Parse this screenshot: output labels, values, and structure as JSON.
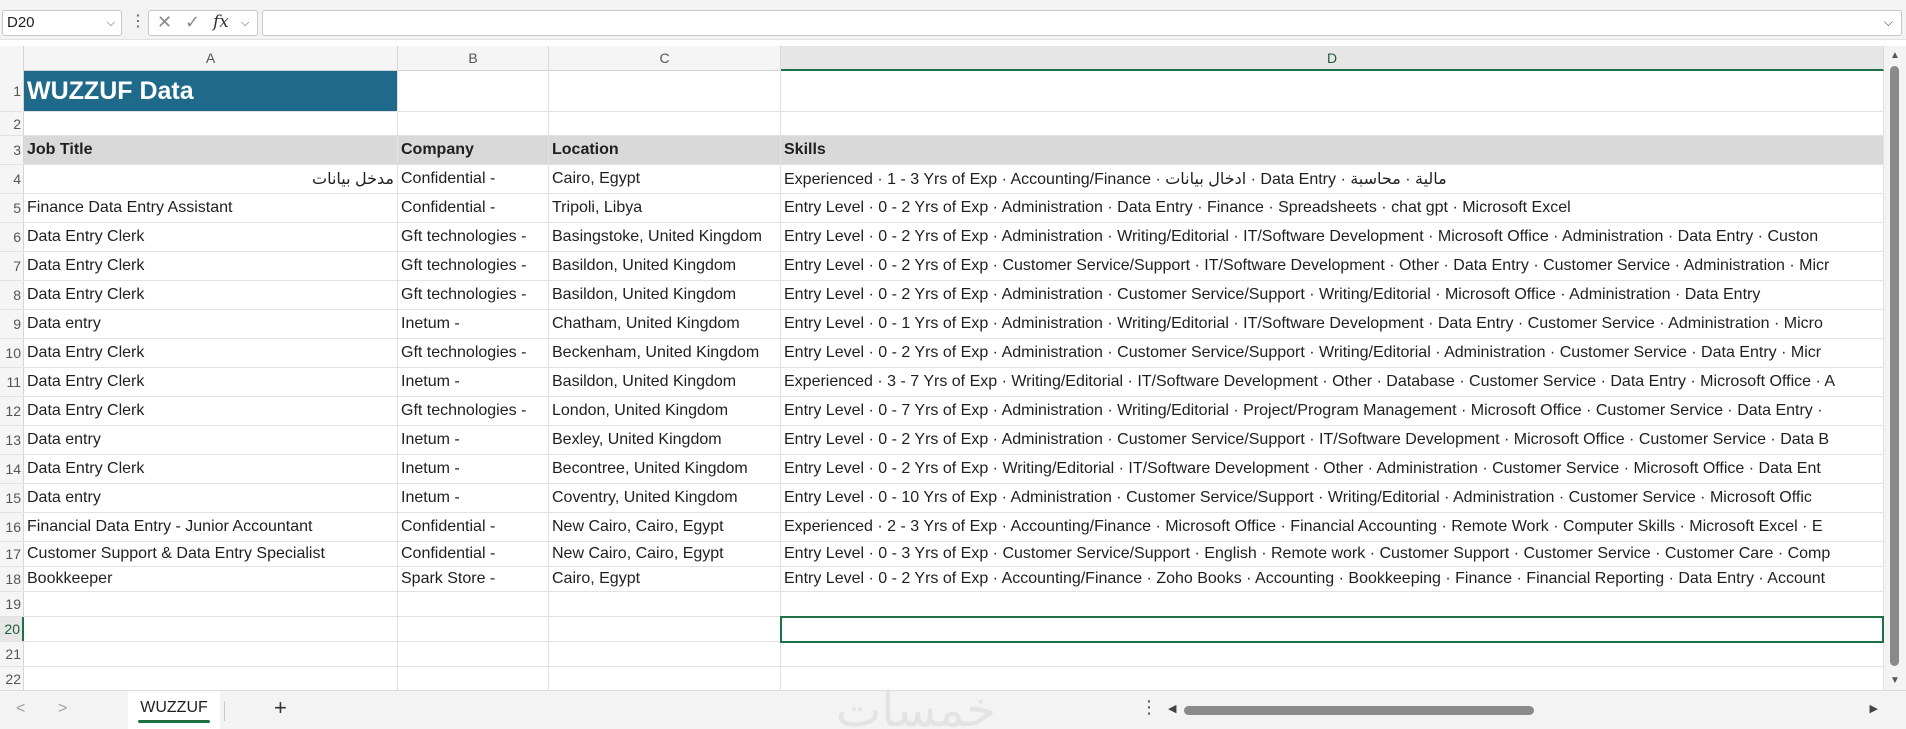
{
  "formula_bar": {
    "name_box": "D20",
    "cancel_icon": "✕",
    "enter_icon": "✓",
    "fx_label": "fx",
    "formula_value": ""
  },
  "columns": [
    "A",
    "B",
    "C",
    "D"
  ],
  "active_column": "D",
  "row_numbers": [
    "1",
    "2",
    "3",
    "4",
    "5",
    "6",
    "7",
    "8",
    "9",
    "10",
    "11",
    "12",
    "13",
    "14",
    "15",
    "16",
    "17",
    "18",
    "19",
    "20",
    "21",
    "22"
  ],
  "title": "WUZZUF Data",
  "headers": {
    "job_title": "Job Title",
    "company": "Company",
    "location": "Location",
    "skills": "Skills"
  },
  "rows": [
    {
      "job_title": "مدخل بيانات",
      "company": "Confidential -",
      "location": "Cairo, Egypt",
      "skills": "Experienced · 1 - 3 Yrs of Exp · Accounting/Finance · ادخال بيانات · Data Entry · مالية · محاسبة"
    },
    {
      "job_title": "Finance Data Entry Assistant",
      "company": "Confidential -",
      "location": "Tripoli, Libya",
      "skills": "Entry Level · 0 - 2 Yrs of Exp · Administration · Data Entry · Finance · Spreadsheets · chat gpt · Microsoft Excel"
    },
    {
      "job_title": "Data Entry Clerk",
      "company": "Gft technologies -",
      "location": "Basingstoke, United Kingdom",
      "skills": "Entry Level · 0 - 2 Yrs of Exp · Administration · Writing/Editorial · IT/Software Development · Microsoft Office · Administration · Data Entry · Custon"
    },
    {
      "job_title": "Data Entry Clerk",
      "company": "Gft technologies -",
      "location": "Basildon, United Kingdom",
      "skills": "Entry Level · 0 - 2 Yrs of Exp · Customer Service/Support · IT/Software Development · Other · Data Entry · Customer Service · Administration · Micr"
    },
    {
      "job_title": "Data Entry Clerk",
      "company": "Gft technologies -",
      "location": "Basildon, United Kingdom",
      "skills": "Entry Level · 0 - 2 Yrs of Exp · Administration · Customer Service/Support · Writing/Editorial · Microsoft Office · Administration · Data Entry"
    },
    {
      "job_title": "Data entry",
      "company": "Inetum -",
      "location": "Chatham, United Kingdom",
      "skills": "Entry Level · 0 - 1 Yrs of Exp · Administration · Writing/Editorial · IT/Software Development · Data Entry · Customer Service · Administration · Micro"
    },
    {
      "job_title": "Data Entry Clerk",
      "company": "Gft technologies -",
      "location": "Beckenham, United Kingdom",
      "skills": "Entry Level · 0 - 2 Yrs of Exp · Administration · Customer Service/Support · Writing/Editorial · Administration · Customer Service · Data Entry · Micr"
    },
    {
      "job_title": "Data Entry Clerk",
      "company": "Inetum -",
      "location": "Basildon, United Kingdom",
      "skills": "Experienced · 3 - 7 Yrs of Exp · Writing/Editorial · IT/Software Development · Other · Database · Customer Service · Data Entry · Microsoft Office · A"
    },
    {
      "job_title": "Data Entry Clerk",
      "company": "Gft technologies -",
      "location": "London, United Kingdom",
      "skills": "Entry Level · 0 - 7 Yrs of Exp · Administration · Writing/Editorial · Project/Program Management · Microsoft Office · Customer Service · Data Entry ·"
    },
    {
      "job_title": "Data entry",
      "company": "Inetum -",
      "location": "Bexley, United Kingdom",
      "skills": "Entry Level · 0 - 2 Yrs of Exp · Administration · Customer Service/Support · IT/Software Development · Microsoft Office · Customer Service · Data B"
    },
    {
      "job_title": "Data Entry Clerk",
      "company": "Inetum -",
      "location": "Becontree, United Kingdom",
      "skills": "Entry Level · 0 - 2 Yrs of Exp · Writing/Editorial · IT/Software Development · Other · Administration · Customer Service · Microsoft Office · Data Ent"
    },
    {
      "job_title": "Data entry",
      "company": "Inetum -",
      "location": "Coventry, United Kingdom",
      "skills": "Entry Level · 0 - 10 Yrs of Exp · Administration · Customer Service/Support · Writing/Editorial · Administration · Customer Service · Microsoft Offic"
    },
    {
      "job_title": "Financial Data Entry - Junior Accountant",
      "company": "Confidential -",
      "location": "New Cairo, Cairo, Egypt",
      "skills": "Experienced · 2 - 3 Yrs of Exp · Accounting/Finance · Microsoft Office · Financial Accounting · Remote Work · Computer Skills · Microsoft Excel · E"
    },
    {
      "job_title": "Customer Support & Data Entry Specialist",
      "company": "Confidential -",
      "location": "New Cairo, Cairo, Egypt",
      "skills": "Entry Level · 0 - 3 Yrs of Exp · Customer Service/Support · English · Remote work · Customer Support · Customer Service · Customer Care · Comp"
    },
    {
      "job_title": "Bookkeeper",
      "company": "Spark Store -",
      "location": "Cairo, Egypt",
      "skills": "Entry Level · 0 - 2 Yrs of Exp · Accounting/Finance · Zoho Books · Accounting · Bookkeeping · Finance · Financial Reporting · Data Entry · Account"
    }
  ],
  "sheet_tab": "WUZZUF",
  "add_sheet_label": "+",
  "watermark": "خمسات",
  "colors": {
    "title_fill": "#1f6a8a",
    "header_fill": "#d9d9d9",
    "selection": "#1e7145"
  }
}
